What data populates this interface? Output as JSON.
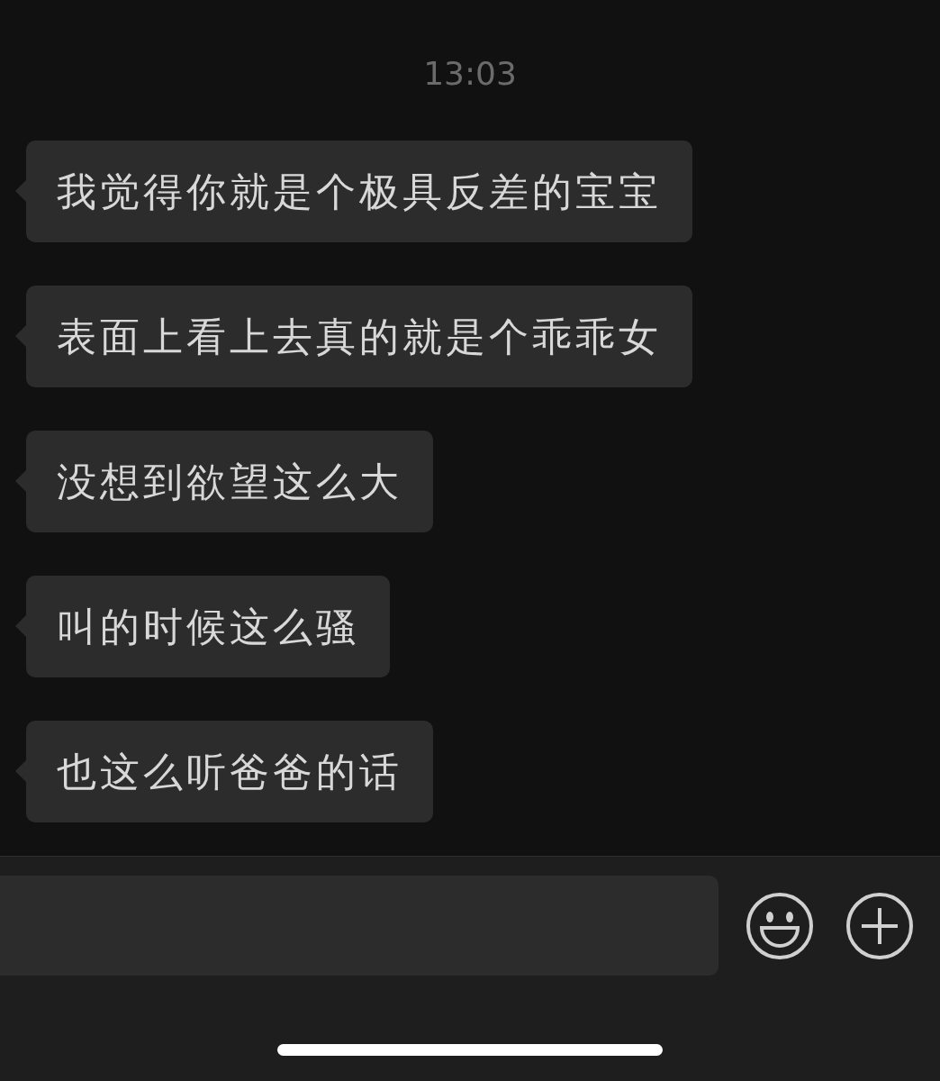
{
  "timestamp": "13:03",
  "messages": [
    {
      "text": "我觉得你就是个极具反差的宝宝"
    },
    {
      "text": "表面上看上去真的就是个乖乖女"
    },
    {
      "text": "没想到欲望这么大"
    },
    {
      "text": "叫的时候这么骚"
    },
    {
      "text": "也这么听爸爸的话"
    }
  ]
}
